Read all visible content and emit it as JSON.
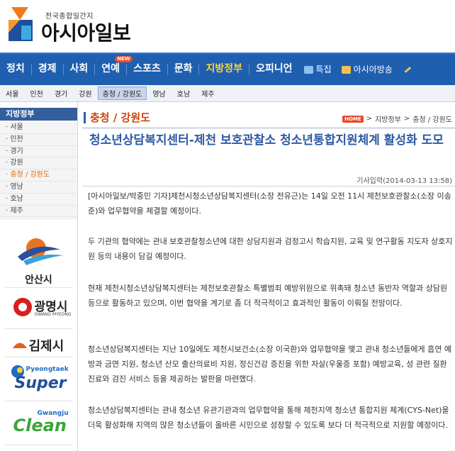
{
  "header": {
    "logo_sub": "전국종합일간지",
    "logo_main": "아시아일보"
  },
  "nav": {
    "items": [
      "정치",
      "경제",
      "사회",
      "연예",
      "스포츠",
      "문화",
      "지방정부",
      "오피니언"
    ],
    "active": "지방정부",
    "new_badge": "NEW",
    "extra": [
      "특집",
      "아시아방송"
    ]
  },
  "subnav": {
    "items": [
      "서울",
      "인천",
      "경기",
      "강원",
      "충청 / 강원도",
      "영남",
      "호남",
      "제주"
    ]
  },
  "sidebar": {
    "title": "지방정부",
    "items": [
      "서울",
      "인천",
      "경기",
      "강원",
      "충청 / 강원도",
      "영남",
      "호남",
      "제주"
    ],
    "banners": [
      "안산시",
      "광명시",
      "GWANG MYEONG",
      "김제시",
      "Pyeongtaek",
      "Super",
      "Gwangju",
      "Clean"
    ]
  },
  "article": {
    "category": "충청 / 강원도",
    "breadcrumb": {
      "home": "HOME",
      "section": "지방정부",
      "sub": "충청 / 강원도"
    },
    "headline": "청소년상담복지센터-제천 보호관찰소 청소년통합지원체계 활성화 도모",
    "dateline": "기사입력(2014-03-13 13:58)",
    "paragraphs": [
      "[아시아일보/박중민 기자]제천시청소년상담복지센터(소장 전유근)는 14일 오전 11시 제천보호관찰소(소장 이송준)와 업무협약을 체결할 예정이다.",
      "두 기관의 협약에는 관내 보호관찰청소년에 대한 상담지원과 검정고시 학습지원, 교육 및 연구활동 지도자 상호지원 등의 내용이 담길 예정이다.",
      "현재 제천시청소년상담복지센터는 제천보호관찰소 특별범죄 예방위원으로 위촉돼 청소년 동반자 역할과 상담원등으로 활동하고 있으며, 이번 협약을 계기로 좀 더 적극적이고 효과적인 활동이 이뤄질 전망이다.",
      "청소년상담복지센터는 지난 10일에도 제천시보건소(소장 이국환)와 업무협약을 맺고 관내 청소년들에게 흡연 예방과 금연 지원, 청소년 산모 출산의료비 지원, 정신건강 증진을 위한 자살(우울증 포함) 예방교육, 성 관련 질환 진료와 검진 서비스 등을 제공하는 발판을 마련했다.",
      "청소년상담복지센터는 관내 청소년 유관기관과의 업무협약을 통해 제천지역 청소년 통합지원 체계(CYS-Net)을 더욱 활성화해 지역의 많은 청소년들이 올바른 시민으로 성장할 수 있도록 보다 더 적극적으로 지원할 예정이다."
    ]
  },
  "colors": {
    "nav_bg": "#1e5fb0",
    "accent": "#d2440a",
    "headline": "#2d5aa5",
    "active_nav": "#ffd23a"
  }
}
